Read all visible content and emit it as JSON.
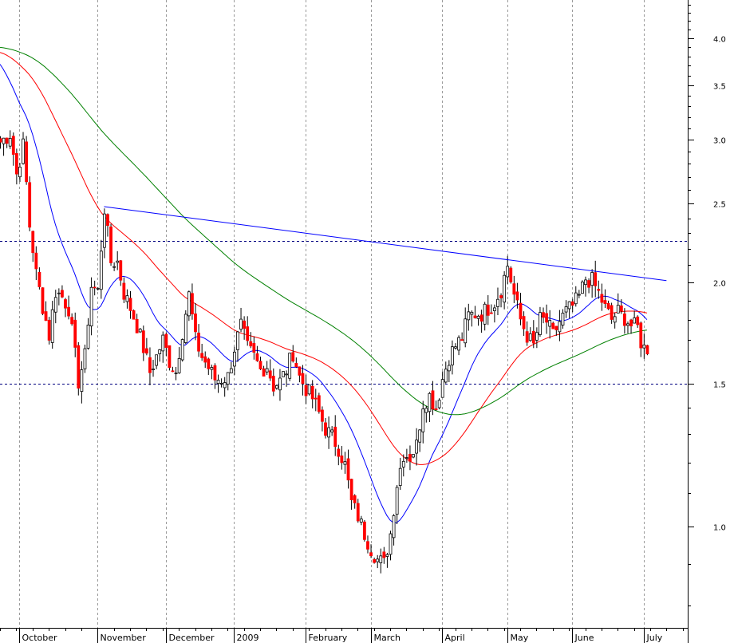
{
  "chart_data": {
    "type": "candlestick",
    "title": "",
    "xlabel": "",
    "ylabel": "",
    "y_scale": "log",
    "ylim": [
      0.8,
      4.6
    ],
    "y_ticks": [
      1.0,
      1.5,
      2.0,
      2.5,
      3.0,
      3.5,
      4.0
    ],
    "y_tick_labels": [
      "1.0",
      "1.5",
      "2.0",
      "2.5",
      "3.0",
      "3.5",
      "4.0"
    ],
    "months": [
      {
        "label": "October",
        "d0": 6
      },
      {
        "label": "November",
        "d0": 30
      },
      {
        "label": "December",
        "d0": 51
      },
      {
        "label": "2009",
        "d0": 72
      },
      {
        "label": "February",
        "d0": 94
      },
      {
        "label": "March",
        "d0": 114
      },
      {
        "label": "April",
        "d0": 136
      },
      {
        "label": "May",
        "d0": 156
      },
      {
        "label": "June",
        "d0": 176
      },
      {
        "label": "July",
        "d0": 198
      }
    ],
    "trading_days": 200,
    "grid": "vertical dotted at month starts",
    "colors": {
      "up": "#ffffff",
      "down": "#ff0000",
      "outline": "#000000",
      "ma_fast": "#0000ff",
      "ma_mid": "#ff0000",
      "ma_slow": "#008000",
      "trendline": "#0000ff",
      "level": "#000080"
    },
    "horizontal_levels": [
      2.25,
      1.5
    ],
    "trendline": [
      {
        "d": 32,
        "y": 2.48
      },
      {
        "d": 205,
        "y": 2.01
      }
    ],
    "anchors": [
      [
        0,
        2.98
      ],
      [
        3,
        3.05
      ],
      [
        5,
        2.72
      ],
      [
        7,
        2.95
      ],
      [
        9,
        2.35
      ],
      [
        11,
        2.05
      ],
      [
        13,
        1.87
      ],
      [
        15,
        1.72
      ],
      [
        17,
        1.95
      ],
      [
        19,
        1.92
      ],
      [
        21,
        1.86
      ],
      [
        22,
        1.74
      ],
      [
        24,
        1.51
      ],
      [
        26,
        1.62
      ],
      [
        28,
        1.98
      ],
      [
        30,
        1.95
      ],
      [
        32,
        2.47
      ],
      [
        34,
        2.12
      ],
      [
        36,
        2.12
      ],
      [
        38,
        1.94
      ],
      [
        40,
        1.86
      ],
      [
        42,
        1.77
      ],
      [
        44,
        1.66
      ],
      [
        46,
        1.55
      ],
      [
        48,
        1.62
      ],
      [
        50,
        1.7
      ],
      [
        52,
        1.6
      ],
      [
        54,
        1.55
      ],
      [
        56,
        1.74
      ],
      [
        58,
        1.93
      ],
      [
        60,
        1.7
      ],
      [
        62,
        1.62
      ],
      [
        64,
        1.57
      ],
      [
        66,
        1.52
      ],
      [
        68,
        1.52
      ],
      [
        70,
        1.53
      ],
      [
        72,
        1.66
      ],
      [
        74,
        1.77
      ],
      [
        76,
        1.66
      ],
      [
        78,
        1.62
      ],
      [
        80,
        1.56
      ],
      [
        82,
        1.58
      ],
      [
        84,
        1.49
      ],
      [
        86,
        1.51
      ],
      [
        88,
        1.56
      ],
      [
        90,
        1.64
      ],
      [
        92,
        1.53
      ],
      [
        94,
        1.48
      ],
      [
        96,
        1.44
      ],
      [
        98,
        1.38
      ],
      [
        100,
        1.32
      ],
      [
        102,
        1.29
      ],
      [
        104,
        1.25
      ],
      [
        106,
        1.19
      ],
      [
        108,
        1.07
      ],
      [
        110,
        1.03
      ],
      [
        112,
        0.98
      ],
      [
        114,
        0.94
      ],
      [
        116,
        0.91
      ],
      [
        118,
        0.9
      ],
      [
        120,
        0.98
      ],
      [
        122,
        1.13
      ],
      [
        124,
        1.23
      ],
      [
        126,
        1.22
      ],
      [
        128,
        1.26
      ],
      [
        130,
        1.42
      ],
      [
        132,
        1.45
      ],
      [
        134,
        1.4
      ],
      [
        136,
        1.52
      ],
      [
        138,
        1.62
      ],
      [
        140,
        1.67
      ],
      [
        142,
        1.71
      ],
      [
        144,
        1.82
      ],
      [
        146,
        1.83
      ],
      [
        148,
        1.83
      ],
      [
        150,
        1.86
      ],
      [
        152,
        1.89
      ],
      [
        154,
        1.96
      ],
      [
        156,
        2.1
      ],
      [
        158,
        1.93
      ],
      [
        160,
        1.8
      ],
      [
        162,
        1.72
      ],
      [
        164,
        1.67
      ],
      [
        166,
        1.8
      ],
      [
        168,
        1.79
      ],
      [
        170,
        1.72
      ],
      [
        172,
        1.79
      ],
      [
        174,
        1.84
      ],
      [
        176,
        1.87
      ],
      [
        178,
        1.92
      ],
      [
        180,
        2.02
      ],
      [
        182,
        2.01
      ],
      [
        184,
        1.94
      ],
      [
        186,
        1.86
      ],
      [
        188,
        1.8
      ],
      [
        190,
        1.84
      ],
      [
        192,
        1.81
      ],
      [
        194,
        1.77
      ],
      [
        196,
        1.76
      ],
      [
        197,
        1.69
      ],
      [
        198,
        1.66
      ]
    ]
  }
}
